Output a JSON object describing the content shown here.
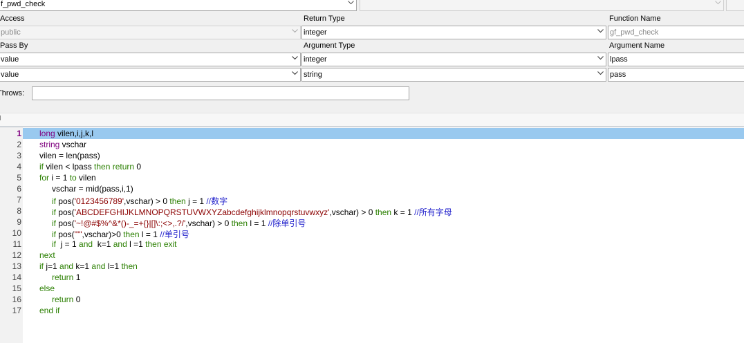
{
  "object_selector": {
    "value": "f_pwd_check"
  },
  "header_labels": {
    "access": "Access",
    "return_type": "Return Type",
    "function_name": "Function Name",
    "pass_by": "Pass By",
    "argument_type": "Argument Type",
    "argument_name": "Argument Name",
    "throws": "Throws:"
  },
  "signature": {
    "access": "public",
    "return_type": "integer",
    "function_name": "gf_pwd_check"
  },
  "arguments": [
    {
      "pass_by": "value",
      "type": "integer",
      "name": "lpass"
    },
    {
      "pass_by": "value",
      "type": "string",
      "name": "pass"
    }
  ],
  "throws_value": "",
  "section_marker": "I",
  "editor": {
    "current_line": 1,
    "lines": [
      {
        "n": "1",
        "indent": "",
        "tokens": [
          {
            "t": "long",
            "c": "ty"
          },
          {
            "t": " vilen,i,j,k,l",
            "c": ""
          }
        ]
      },
      {
        "n": "2",
        "indent": "",
        "tokens": [
          {
            "t": "string",
            "c": "ty"
          },
          {
            "t": " vschar",
            "c": ""
          }
        ]
      },
      {
        "n": "3",
        "indent": "",
        "tokens": [
          {
            "t": "vilen = len(pass)",
            "c": ""
          }
        ]
      },
      {
        "n": "4",
        "indent": "",
        "tokens": [
          {
            "t": "if",
            "c": "kw"
          },
          {
            "t": " vilen < lpass ",
            "c": ""
          },
          {
            "t": "then return",
            "c": "kw"
          },
          {
            "t": " 0",
            "c": ""
          }
        ]
      },
      {
        "n": "5",
        "indent": "",
        "tokens": [
          {
            "t": "for",
            "c": "kw"
          },
          {
            "t": " i = 1 ",
            "c": ""
          },
          {
            "t": "to",
            "c": "kw"
          },
          {
            "t": " vilen",
            "c": ""
          }
        ]
      },
      {
        "n": "6",
        "indent": "   ",
        "tokens": [
          {
            "t": "vschar = mid(pass,i,1)",
            "c": ""
          }
        ]
      },
      {
        "n": "7",
        "indent": "   ",
        "tokens": [
          {
            "t": "if",
            "c": "kw"
          },
          {
            "t": " pos(",
            "c": ""
          },
          {
            "t": "'0123456789'",
            "c": "str"
          },
          {
            "t": ",vschar) > 0 ",
            "c": ""
          },
          {
            "t": "then",
            "c": "kw"
          },
          {
            "t": " j = 1 ",
            "c": ""
          },
          {
            "t": "//数字",
            "c": "cm"
          }
        ]
      },
      {
        "n": "8",
        "indent": "   ",
        "tokens": [
          {
            "t": "if",
            "c": "kw"
          },
          {
            "t": " pos(",
            "c": ""
          },
          {
            "t": "'ABCDEFGHIJKLMNOPQRSTUVWXYZabcdefghijklmnopqrstuvwxyz'",
            "c": "str"
          },
          {
            "t": ",vschar) > 0 ",
            "c": ""
          },
          {
            "t": "then",
            "c": "kw"
          },
          {
            "t": " k = 1 ",
            "c": ""
          },
          {
            "t": "//所有字母",
            "c": "cm"
          }
        ]
      },
      {
        "n": "9",
        "indent": "   ",
        "tokens": [
          {
            "t": "if",
            "c": "kw"
          },
          {
            "t": " pos(",
            "c": ""
          },
          {
            "t": "'~!@#$%^&*()-_=+{}|[]\\:;<>,.?/'",
            "c": "str"
          },
          {
            "t": ",vschar) > 0 ",
            "c": ""
          },
          {
            "t": "then",
            "c": "kw"
          },
          {
            "t": " l = 1 ",
            "c": ""
          },
          {
            "t": "//除单引号",
            "c": "cm"
          }
        ]
      },
      {
        "n": "10",
        "indent": "   ",
        "tokens": [
          {
            "t": "if",
            "c": "kw"
          },
          {
            "t": " pos(",
            "c": ""
          },
          {
            "t": "\"'\"",
            "c": "str"
          },
          {
            "t": ",vschar)>0 ",
            "c": ""
          },
          {
            "t": "then",
            "c": "kw"
          },
          {
            "t": " l = 1 ",
            "c": ""
          },
          {
            "t": "//单引号",
            "c": "cm"
          }
        ]
      },
      {
        "n": "11",
        "indent": "   ",
        "tokens": [
          {
            "t": "if",
            "c": "kw"
          },
          {
            "t": "  j = 1 ",
            "c": ""
          },
          {
            "t": "and",
            "c": "kw"
          },
          {
            "t": "  k=1 ",
            "c": ""
          },
          {
            "t": "and",
            "c": "kw"
          },
          {
            "t": " l =1 ",
            "c": ""
          },
          {
            "t": "then exit",
            "c": "kw"
          }
        ]
      },
      {
        "n": "12",
        "indent": "",
        "tokens": [
          {
            "t": "next",
            "c": "kw"
          }
        ]
      },
      {
        "n": "13",
        "indent": "",
        "tokens": [
          {
            "t": "if",
            "c": "kw"
          },
          {
            "t": " j=1 ",
            "c": ""
          },
          {
            "t": "and",
            "c": "kw"
          },
          {
            "t": " k=1 ",
            "c": ""
          },
          {
            "t": "and",
            "c": "kw"
          },
          {
            "t": " l=1 ",
            "c": ""
          },
          {
            "t": "then",
            "c": "kw"
          }
        ]
      },
      {
        "n": "14",
        "indent": "   ",
        "tokens": [
          {
            "t": "return",
            "c": "kw"
          },
          {
            "t": " 1",
            "c": ""
          }
        ]
      },
      {
        "n": "15",
        "indent": "",
        "tokens": [
          {
            "t": "else",
            "c": "kw"
          }
        ]
      },
      {
        "n": "16",
        "indent": "   ",
        "tokens": [
          {
            "t": "return",
            "c": "kw"
          },
          {
            "t": " 0",
            "c": ""
          }
        ]
      },
      {
        "n": "17",
        "indent": "",
        "tokens": [
          {
            "t": "end if",
            "c": "kw"
          }
        ]
      }
    ]
  },
  "colors": {
    "current_line_bg": "#99c9ef",
    "keyword": "#2a7f00",
    "type": "#7f007f",
    "string": "#8b0000",
    "comment": "#2222cc"
  }
}
